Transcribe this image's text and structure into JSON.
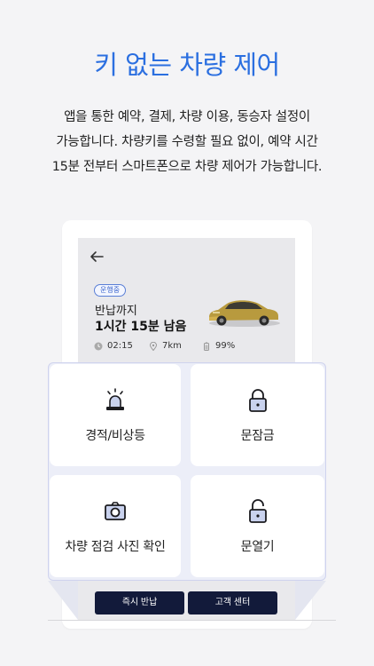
{
  "headline": "키 없는 차량 제어",
  "description": [
    "앱을 통한 예약, 결제, 차량 이용, 동승자 설정이",
    "가능합니다. 차량키를 수령할 필요 없이, 예약 시간",
    "15분 전부터 스마트폰으로 차량 제어가 가능합니다."
  ],
  "trip": {
    "status_badge": "운행중",
    "remain_label": "반납까지",
    "remain_time": "1시간 15분 남음",
    "stats": {
      "time": "02:15",
      "distance": "7km",
      "battery": "99%"
    }
  },
  "controls": [
    {
      "label": "경적/비상등",
      "icon": "siren-icon"
    },
    {
      "label": "문잠금",
      "icon": "lock-icon"
    },
    {
      "label": "차량 점검 사진 확인",
      "icon": "camera-icon"
    },
    {
      "label": "문열기",
      "icon": "unlock-icon"
    }
  ],
  "buttons": {
    "return": "즉시 반납",
    "support": "고객 센터"
  },
  "colors": {
    "accent": "#2b6fe0",
    "button_bg": "#121a3a",
    "panel_bg": "#eceef8"
  }
}
